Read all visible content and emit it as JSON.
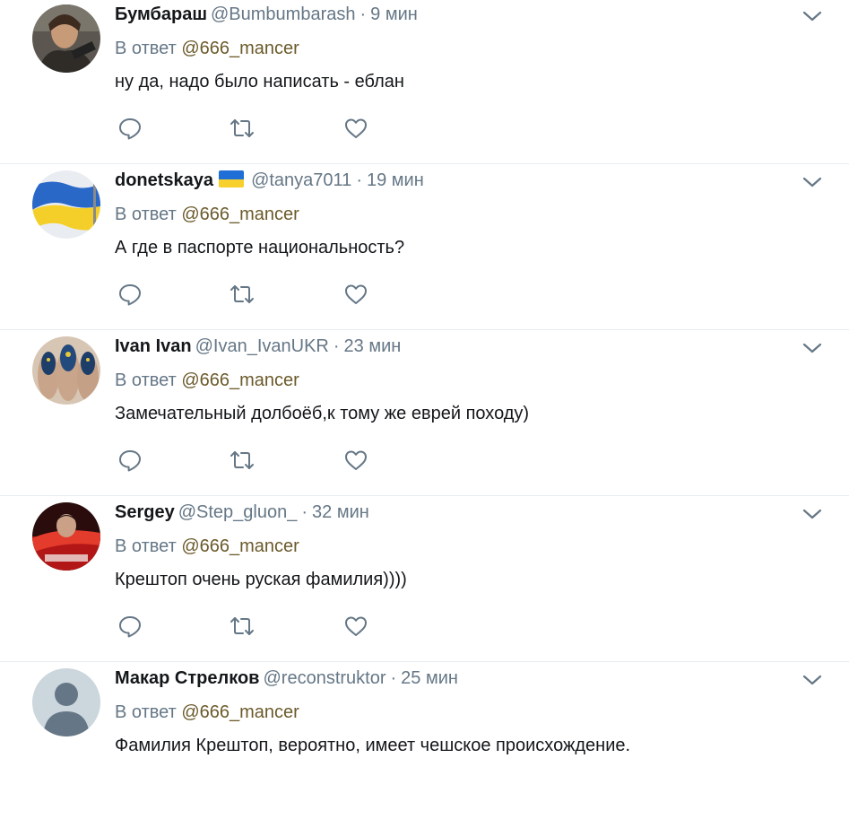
{
  "tweets": [
    {
      "name": "Бумбараш",
      "handle": "@Bumbumbarash",
      "time": "9 мин",
      "reply_prefix": "В ответ",
      "reply_to": "@666_mancer",
      "text": "ну да, надо было написать - еблан",
      "flag": false,
      "avatar_kind": "portrait"
    },
    {
      "name": "donetskaya",
      "handle": "@tanya7011",
      "time": "19 мин",
      "reply_prefix": "В ответ",
      "reply_to": "@666_mancer",
      "text": "А где в паспорте национальность?",
      "flag": true,
      "avatar_kind": "ukraine-flag"
    },
    {
      "name": "Ivan Ivan",
      "handle": "@Ivan_IvanUKR",
      "time": "23 мин",
      "reply_prefix": "В ответ",
      "reply_to": "@666_mancer",
      "text": "Замечательный долбоёб,к тому же еврей походу)",
      "flag": false,
      "avatar_kind": "nails"
    },
    {
      "name": "Sergey",
      "handle": "@Step_gluon_",
      "time": "32 мин",
      "reply_prefix": "В ответ",
      "reply_to": "@666_mancer",
      "text": "Крештоп очень руская фамилия))))",
      "flag": false,
      "avatar_kind": "red-photo"
    },
    {
      "name": "Макар Стрелков",
      "handle": "@reconstruktor",
      "time": "25 мин",
      "reply_prefix": "В ответ",
      "reply_to": "@666_mancer",
      "text": "Фамилия Крештоп, вероятно, имеет чешское происхождение.",
      "flag": false,
      "avatar_kind": "default-silhouette"
    }
  ],
  "icons": {
    "reply": "reply-icon",
    "retweet": "retweet-icon",
    "like": "heart-icon",
    "more": "chevron-down-icon"
  },
  "colors": {
    "text": "#14171a",
    "secondary": "#657786",
    "reply_target": "#6b5a2a",
    "divider": "#e6ecf0",
    "flag_blue": "#1f6fd6",
    "flag_yellow": "#f7d02b"
  }
}
